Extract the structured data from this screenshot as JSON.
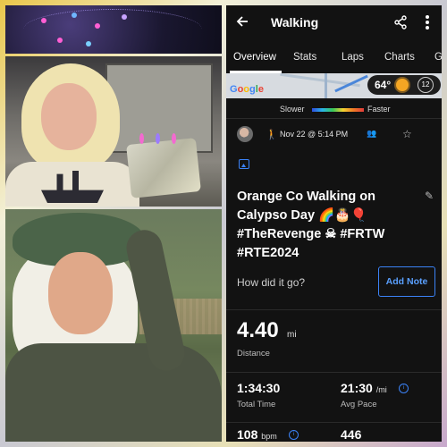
{
  "app": {
    "title": "Walking",
    "back_icon": "arrow-left-icon",
    "share_icon": "share-icon",
    "more_icon": "more-vertical-icon"
  },
  "tabs": [
    {
      "label": "Overview",
      "active": true
    },
    {
      "label": "Stats",
      "active": false
    },
    {
      "label": "Laps",
      "active": false
    },
    {
      "label": "Charts",
      "active": false
    },
    {
      "label": "G",
      "active": false
    }
  ],
  "map": {
    "logo_letters": [
      "G",
      "o",
      "o",
      "g",
      "l",
      "e"
    ],
    "weather": {
      "temperature": "64°",
      "condition_icon": "sun-icon",
      "wind": "12"
    }
  },
  "speed_legend": {
    "slower": "Slower",
    "faster": "Faster"
  },
  "activity": {
    "date": "Nov 22 @ 5:14 PM",
    "name": "Orange Co Walking on Calypso Day 🌈🎂🎈 #TheRevenge ☠ #FRTW #RTE2024",
    "feel_question": "How did it go?",
    "add_note_label": "Add Note"
  },
  "stats": {
    "distance": {
      "value": "4.40",
      "unit": "mi",
      "label": "Distance"
    },
    "total_time": {
      "value": "1:34:30",
      "label": "Total Time"
    },
    "avg_pace": {
      "value": "21:30",
      "unit": "/mi",
      "label": "Avg Pace"
    },
    "heart_rate": {
      "value": "108",
      "unit": "bpm"
    },
    "calories": {
      "value": "446"
    }
  },
  "colors": {
    "accent": "#3b82f6",
    "background": "#121212"
  }
}
